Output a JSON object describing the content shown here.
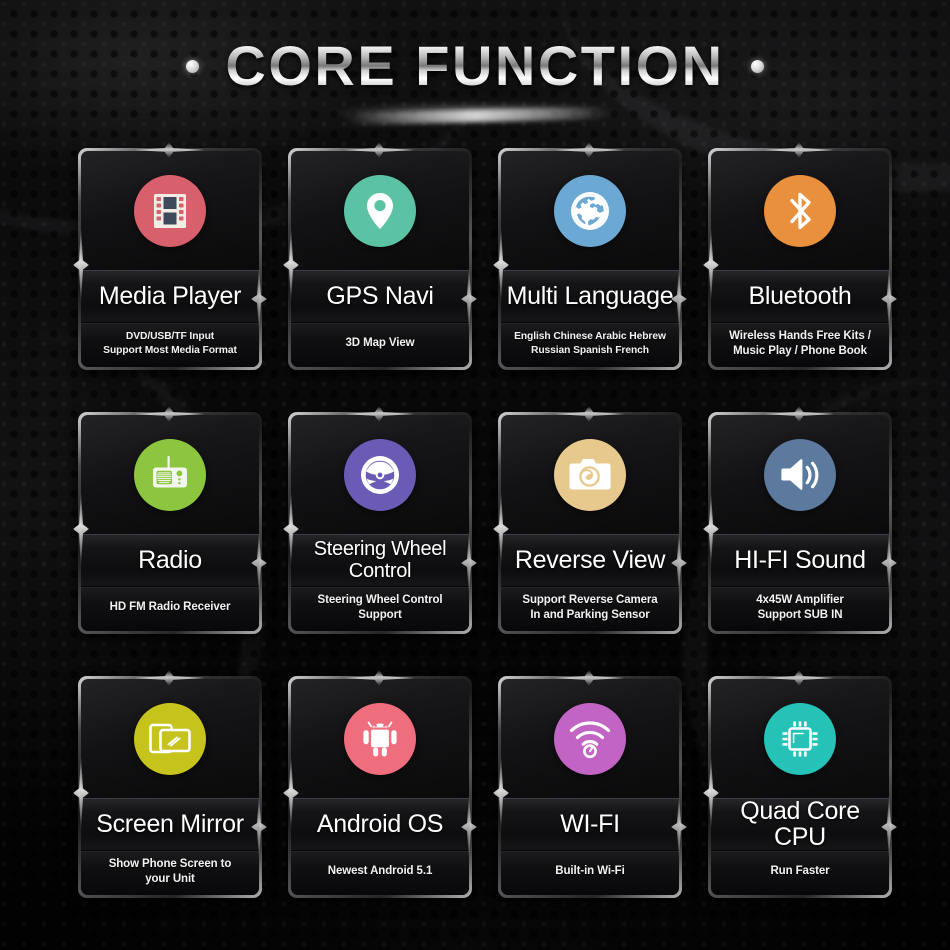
{
  "header": {
    "title": "CORE FUNCTION",
    "left_dot": "bullet-dot",
    "right_dot": "bullet-dot"
  },
  "features": [
    {
      "id": "media-player",
      "name": "Media Player",
      "desc": "DVD/USB/TF Input\nSupport Most Media Format",
      "icon": "film-strip-icon",
      "color": "#D8606C",
      "desc_size": "small",
      "title_lines": 1
    },
    {
      "id": "gps-navi",
      "name": "GPS Navi",
      "desc": "3D Map View",
      "icon": "map-pin-icon",
      "color": "#5CC2A4",
      "desc_size": "normal",
      "title_lines": 1
    },
    {
      "id": "multi-language",
      "name": "Multi Language",
      "desc": "English Chinese Arabic Hebrew\nRussian Spanish French",
      "icon": "globe-icon",
      "color": "#6BA8D3",
      "desc_size": "small",
      "title_lines": 1
    },
    {
      "id": "bluetooth",
      "name": "Bluetooth",
      "desc": "Wireless Hands Free Kits /\nMusic Play / Phone Book",
      "icon": "bluetooth-icon",
      "color": "#E8903E",
      "desc_size": "normal",
      "title_lines": 1
    },
    {
      "id": "radio",
      "name": "Radio",
      "desc": "HD FM Radio Receiver",
      "icon": "radio-icon",
      "color": "#8CC63E",
      "desc_size": "normal",
      "title_lines": 1
    },
    {
      "id": "steering-wheel-control",
      "name": "Steering Wheel\nControl",
      "desc": "Steering Wheel Control\nSupport",
      "icon": "steering-wheel-icon",
      "color": "#6C5BB5",
      "desc_size": "normal",
      "title_lines": 2
    },
    {
      "id": "reverse-view",
      "name": "Reverse View",
      "desc": "Support Reverse Camera\nIn and Parking Sensor",
      "icon": "camera-icon",
      "color": "#E7C98E",
      "desc_size": "normal",
      "title_lines": 1
    },
    {
      "id": "hi-fi-sound",
      "name": "HI-FI Sound",
      "desc": "4x45W Amplifier\nSupport SUB IN",
      "icon": "speaker-icon",
      "color": "#5B7A9E",
      "desc_size": "normal",
      "title_lines": 1
    },
    {
      "id": "screen-mirror",
      "name": "Screen Mirror",
      "desc": "Show Phone Screen to\nyour Unit",
      "icon": "screen-mirror-icon",
      "color": "#C6C31D",
      "desc_size": "normal",
      "title_lines": 1
    },
    {
      "id": "android-os",
      "name": "Android OS",
      "desc": "Newest Android 5.1",
      "icon": "android-robot-icon",
      "color": "#EE6E7E",
      "desc_size": "normal",
      "title_lines": 1
    },
    {
      "id": "wi-fi",
      "name": "WI-FI",
      "desc": "Built-in Wi-Fi",
      "icon": "wifi-icon",
      "color": "#C264C4",
      "desc_size": "normal",
      "title_lines": 1
    },
    {
      "id": "quad-core-cpu",
      "name": "Quad Core CPU",
      "desc": "Run Faster",
      "icon": "cpu-chip-icon",
      "color": "#25C2B8",
      "desc_size": "normal",
      "title_lines": 1
    }
  ]
}
